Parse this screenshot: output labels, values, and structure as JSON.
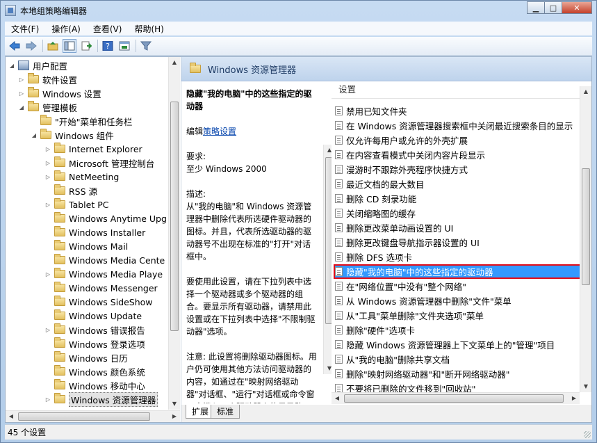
{
  "window": {
    "title": "本地组策略编辑器",
    "caption": {
      "minimize": "▁",
      "maximize": "□",
      "close": "✕"
    }
  },
  "menu": [
    "文件(F)",
    "操作(A)",
    "查看(V)",
    "帮助(H)"
  ],
  "tree": {
    "root": "用户配置",
    "items": [
      {
        "label": "软件设置",
        "level": 1,
        "expander": "▷"
      },
      {
        "label": "Windows 设置",
        "level": 1,
        "expander": "▷"
      },
      {
        "label": "管理模板",
        "level": 1,
        "expander": "◢"
      },
      {
        "label": "\"开始\"菜单和任务栏",
        "level": 2,
        "expander": ""
      },
      {
        "label": "Windows 组件",
        "level": 2,
        "expander": "◢"
      },
      {
        "label": "Internet Explorer",
        "level": 3,
        "expander": "▷"
      },
      {
        "label": "Microsoft 管理控制台",
        "level": 3,
        "expander": "▷"
      },
      {
        "label": "NetMeeting",
        "level": 3,
        "expander": "▷"
      },
      {
        "label": "RSS 源",
        "level": 3,
        "expander": ""
      },
      {
        "label": "Tablet PC",
        "level": 3,
        "expander": "▷"
      },
      {
        "label": "Windows Anytime Upg",
        "level": 3,
        "expander": ""
      },
      {
        "label": "Windows Installer",
        "level": 3,
        "expander": ""
      },
      {
        "label": "Windows Mail",
        "level": 3,
        "expander": ""
      },
      {
        "label": "Windows Media Cente",
        "level": 3,
        "expander": ""
      },
      {
        "label": "Windows Media Playe",
        "level": 3,
        "expander": "▷"
      },
      {
        "label": "Windows Messenger",
        "level": 3,
        "expander": ""
      },
      {
        "label": "Windows SideShow",
        "level": 3,
        "expander": ""
      },
      {
        "label": "Windows Update",
        "level": 3,
        "expander": ""
      },
      {
        "label": "Windows 错误报告",
        "level": 3,
        "expander": "▷"
      },
      {
        "label": "Windows 登录选项",
        "level": 3,
        "expander": ""
      },
      {
        "label": "Windows 日历",
        "level": 3,
        "expander": ""
      },
      {
        "label": "Windows 颜色系统",
        "level": 3,
        "expander": ""
      },
      {
        "label": "Windows 移动中心",
        "level": 3,
        "expander": ""
      },
      {
        "label": "Windows 资源管理器",
        "level": 3,
        "expander": "▷",
        "selected": true
      }
    ]
  },
  "right_header": "Windows 资源管理器",
  "description": {
    "title": "隐藏\"我的电脑\"中的这些指定的驱动器",
    "edit_prefix": "编辑",
    "edit_link": "策略设置",
    "req_label": "要求:",
    "req_value": "至少 Windows 2000",
    "desc_label": "描述:",
    "desc_text": "从\"我的电脑\"和 Windows 资源管理器中删除代表所选硬件驱动器的图标。并且，代表所选驱动器的驱动器号不出现在标准的\"打开\"对话框中。",
    "para2": "要使用此设置，请在下拉列表中选择一个驱动器或多个驱动器的组合。要显示所有驱动器，请禁用此设置或在下拉列表中选择\"不限制驱动器\"选项。",
    "para3": "注意: 此设置将删除驱动器图标。用户仍可使用其他方法访问驱动器的内容，如通过在\"映射网络驱动器\"对话框、\"运行\"对话框或命令窗口中键入一个驱动器上的目录路径。"
  },
  "list": {
    "header": "设置",
    "rows": [
      {
        "label": "禁用已知文件夹"
      },
      {
        "label": "在 Windows 资源管理器搜索框中关闭最近搜索条目的显示"
      },
      {
        "label": "仅允许每用户或允许的外壳扩展"
      },
      {
        "label": "在内容查看模式中关闭内容片段显示"
      },
      {
        "label": "漫游时不跟踪外壳程序快捷方式"
      },
      {
        "label": "最近文档的最大数目"
      },
      {
        "label": "删除 CD 刻录功能"
      },
      {
        "label": "关闭缩略图的缓存"
      },
      {
        "label": "删除更改菜单动画设置的 UI"
      },
      {
        "label": "删除更改键盘导航指示器设置的 UI"
      },
      {
        "label": "删除 DFS 选项卡"
      },
      {
        "label": "隐藏\"我的电脑\"中的这些指定的驱动器",
        "selected": true
      },
      {
        "label": "在\"网络位置\"中没有\"整个网络\""
      },
      {
        "label": "从 Windows 资源管理器中删除\"文件\"菜单"
      },
      {
        "label": "从\"工具\"菜单删除\"文件夹选项\"菜单"
      },
      {
        "label": "删除\"硬件\"选项卡"
      },
      {
        "label": "隐藏 Windows 资源管理器上下文菜单上的\"管理\"项目"
      },
      {
        "label": "从\"我的电脑\"删除共享文档"
      },
      {
        "label": "删除\"映射网络驱动器\"和\"断开网络驱动器\""
      },
      {
        "label": "不要将已删除的文件移到\"回收站\""
      }
    ]
  },
  "tabs": [
    {
      "label": "扩展",
      "active": true
    },
    {
      "label": "标准",
      "active": false
    }
  ],
  "status": "45 个设置"
}
